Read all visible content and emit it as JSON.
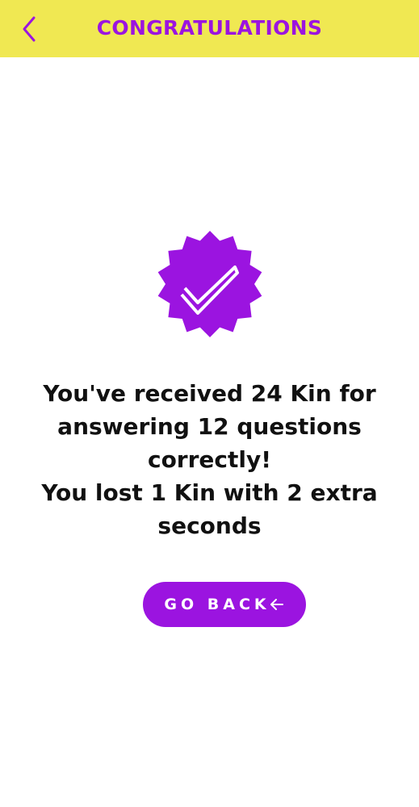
{
  "header": {
    "title": "CONGRATULATIONS",
    "back_icon": "chevron-left-icon"
  },
  "badge": {
    "icon": "verified-check-badge-icon"
  },
  "result": {
    "line1": "You've received 24 Kin for",
    "line2": "answering 12 questions",
    "line3": "correctly!",
    "line4": "You lost 1 Kin with 2 extra",
    "line5": "seconds"
  },
  "go_back": {
    "label": "GO BACK",
    "icon": "arrow-left-icon"
  },
  "colors": {
    "header_bg": "#f0e852",
    "accent": "#9b14e0",
    "text": "#111111",
    "button_text": "#ffffff"
  }
}
